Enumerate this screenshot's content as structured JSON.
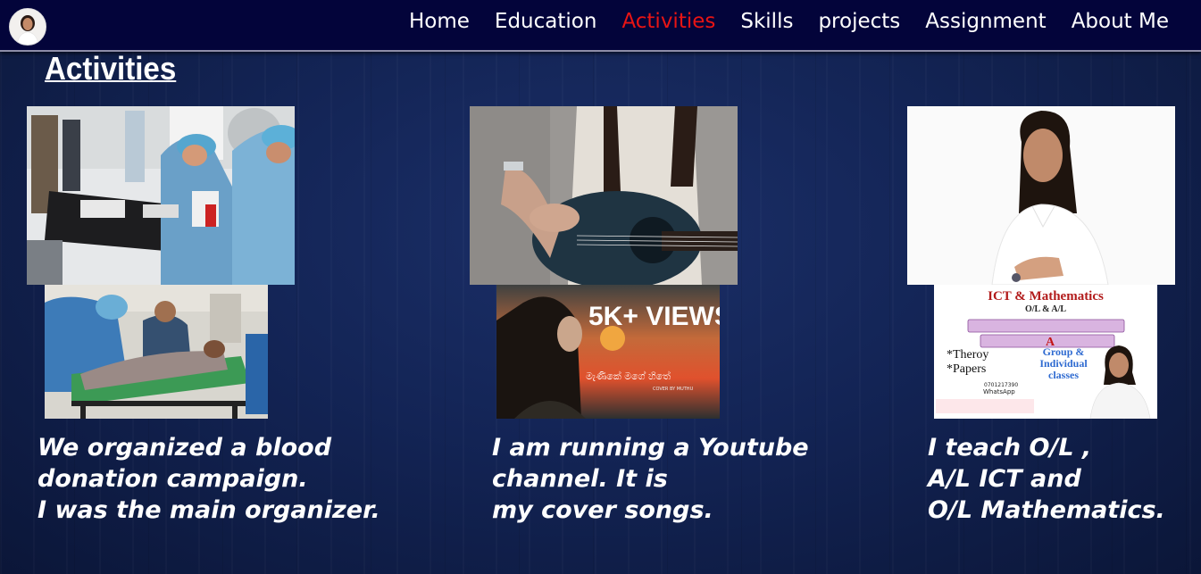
{
  "nav": {
    "avatar_icon": "profile-avatar",
    "links": [
      {
        "label": "Home",
        "active": false
      },
      {
        "label": "Education",
        "active": false
      },
      {
        "label": "Activities",
        "active": true
      },
      {
        "label": "Skills",
        "active": false
      },
      {
        "label": "projects",
        "active": false
      },
      {
        "label": "Assignment",
        "active": false
      },
      {
        "label": "About Me",
        "active": false
      }
    ],
    "active_color": "#e81414"
  },
  "page": {
    "title": "Activities"
  },
  "activities": [
    {
      "lines": [
        "We organized a blood",
        "donation campaign.",
        "I was the main organizer."
      ]
    },
    {
      "lines": [
        "I am running a Youtube",
        "channel. It is",
        "my cover songs."
      ],
      "thumbnail": {
        "headline": "5K+ VIEWS",
        "credit": "COVER BY MUTHU"
      }
    },
    {
      "lines": [
        "I teach O/L ,",
        "A/L ICT and",
        "O/L Mathematics."
      ],
      "poster": {
        "title": "ICT & Mathematics",
        "subtitle": "O/L & A/L",
        "point_1": "*Theroy",
        "point_2": "*Papers",
        "groups_1": "Group &",
        "groups_2": "Individual",
        "groups_3": "classes",
        "phone": "0701217390",
        "whatsapp": "WhatsApp"
      }
    }
  ]
}
